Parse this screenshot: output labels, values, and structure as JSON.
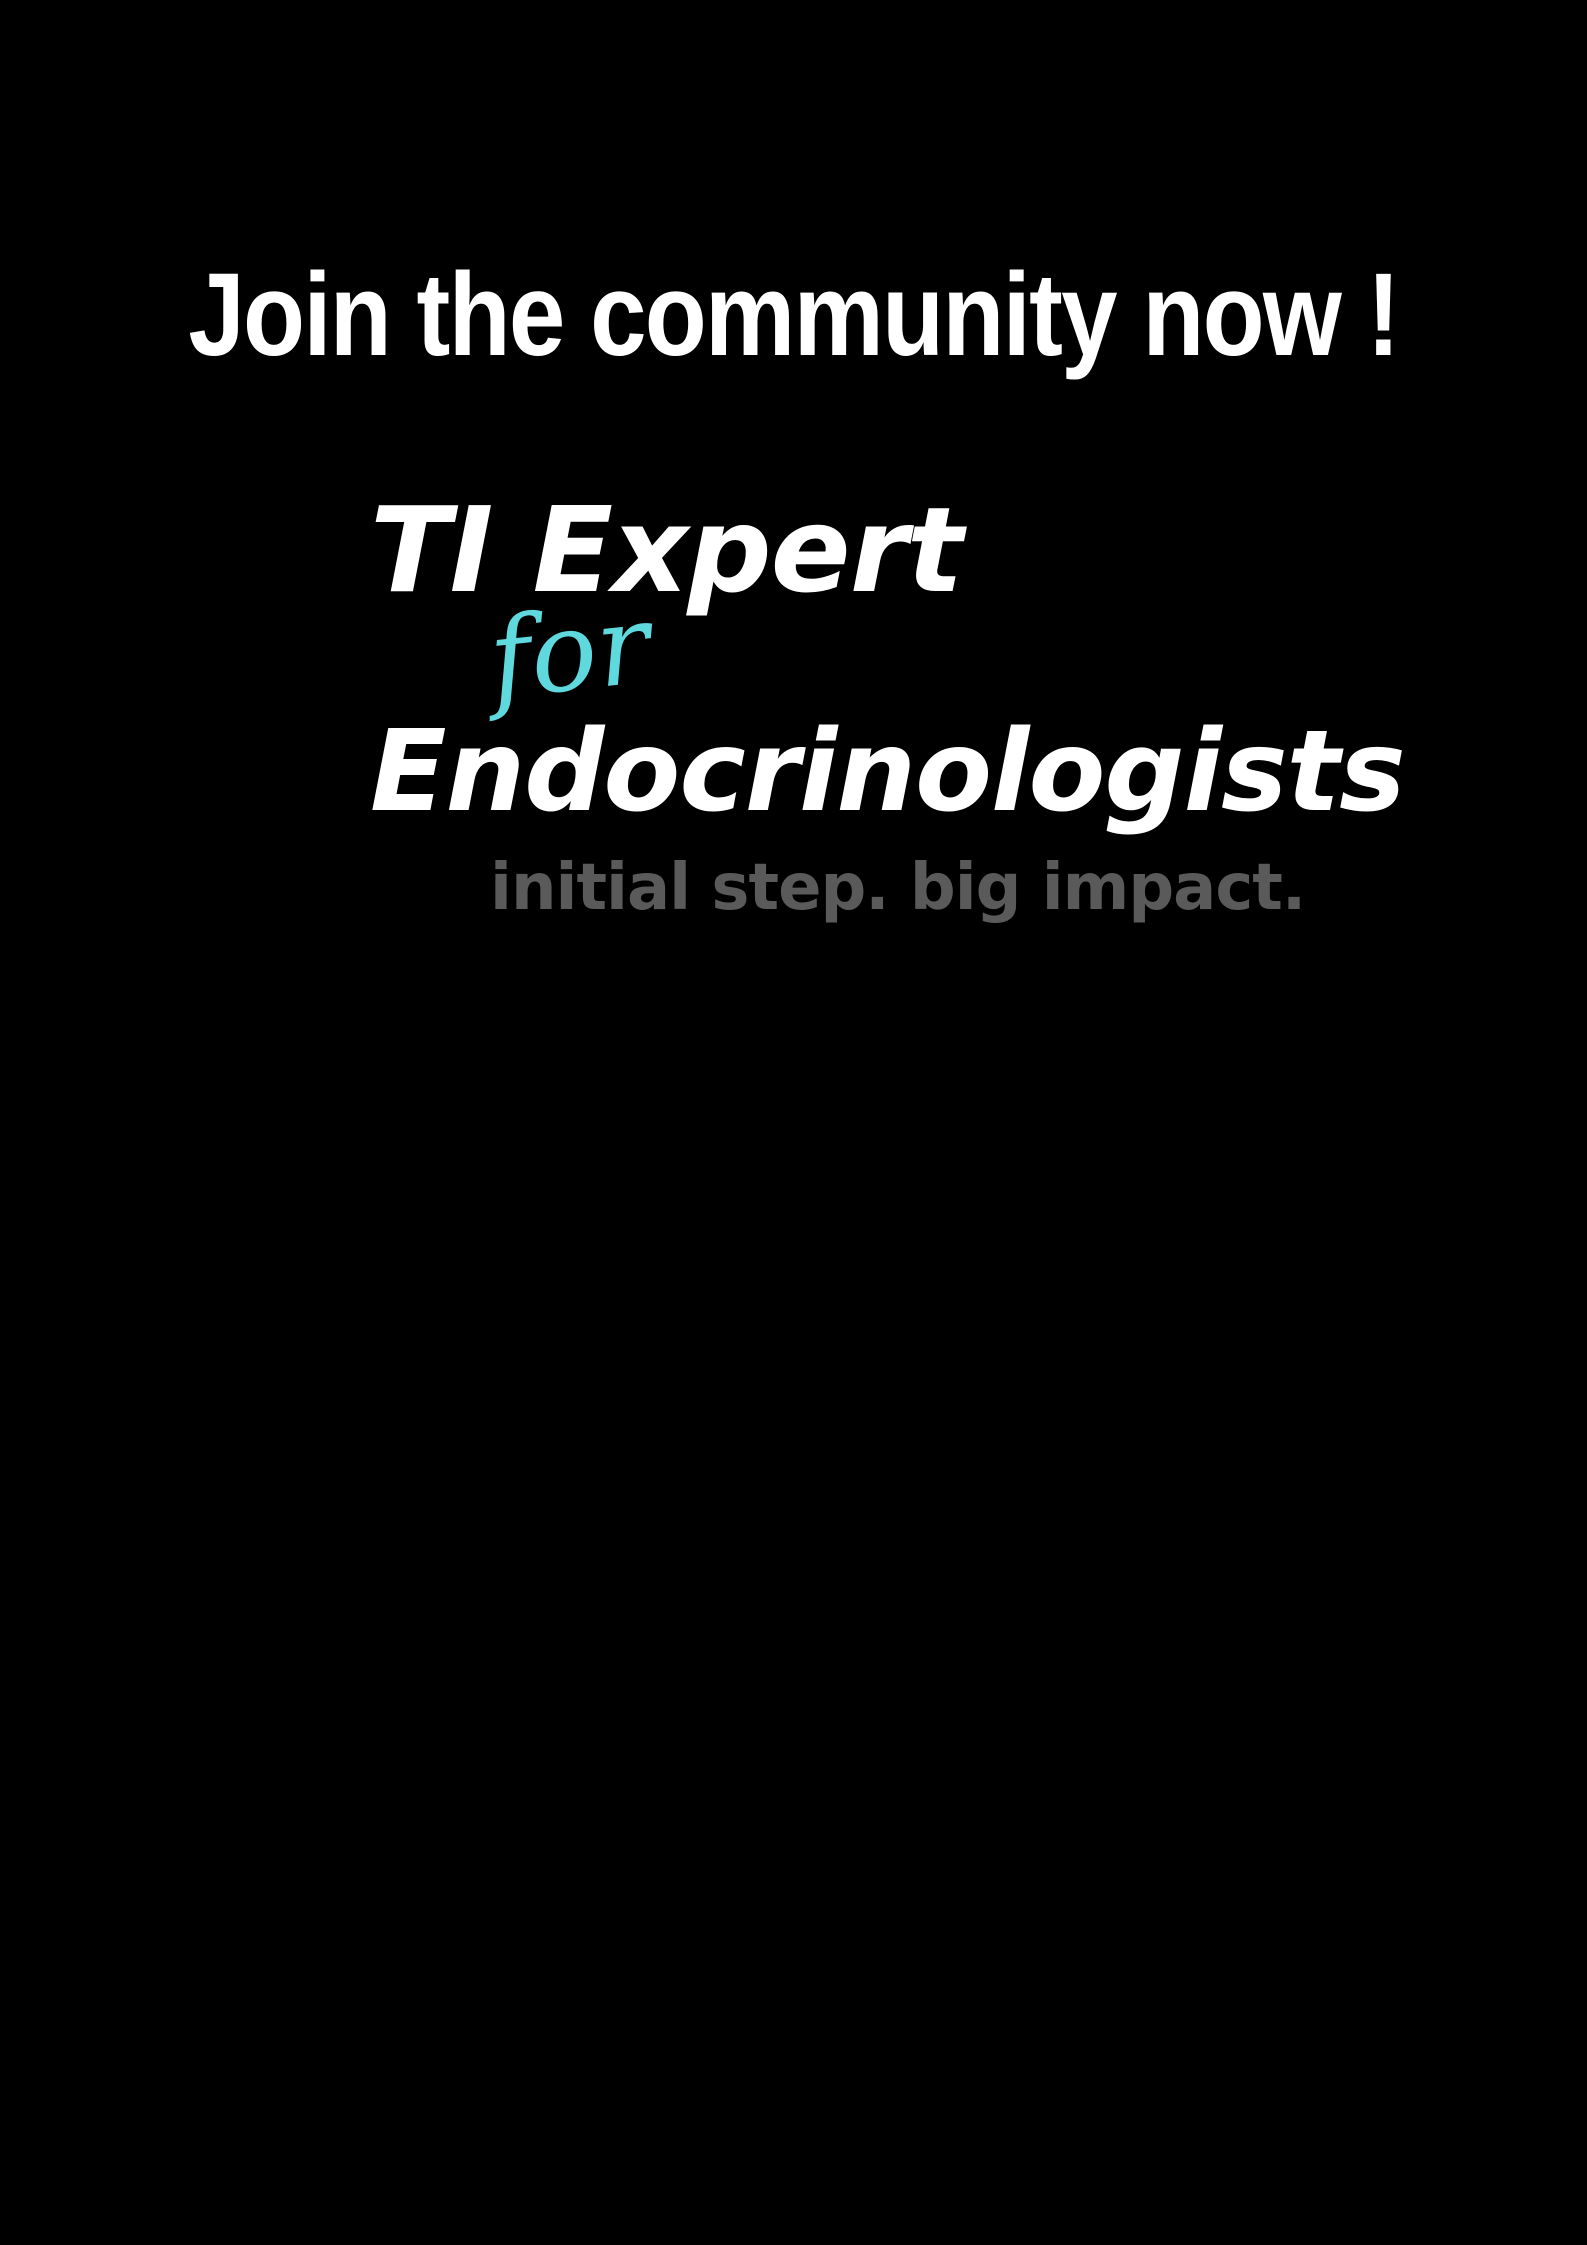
{
  "poster": {
    "headline": "Join the community now !",
    "logo": {
      "line1": "TI Expert",
      "connector": "for",
      "line2": "Endocrinologists"
    },
    "tagline": "initial step. big impact."
  },
  "colors": {
    "background": "#000000",
    "primary_text": "#ffffff",
    "accent": "#5fd8de",
    "tagline": "#5a5a5a"
  }
}
